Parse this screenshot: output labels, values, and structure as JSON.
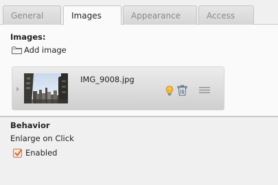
{
  "tabs": [
    {
      "label": "General",
      "active": false
    },
    {
      "label": "Images",
      "active": true
    },
    {
      "label": "Appearance",
      "active": false
    },
    {
      "label": "Access",
      "active": false
    }
  ],
  "images_section": {
    "title": "Images:",
    "add_label": "Add image",
    "items": [
      {
        "filename": "IMG_9008.jpg"
      }
    ]
  },
  "behavior": {
    "title": "Behavior",
    "option_label": "Enlarge on Click",
    "checkbox_label": "Enabled",
    "checked": true
  },
  "colors": {
    "accent": "#d9652b",
    "bulb": "#f3b73b"
  },
  "icons": [
    "folder-icon",
    "expand-arrow-icon",
    "lightbulb-icon",
    "trash-icon",
    "drag-handle-icon",
    "checkmark-icon"
  ]
}
